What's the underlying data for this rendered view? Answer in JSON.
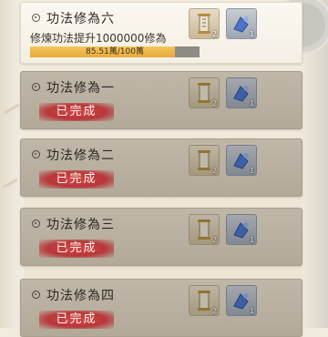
{
  "quests": [
    {
      "title": "功法修為六",
      "description": "修煉功法提升1000000修為",
      "progress_text": "85.51萬/100萬",
      "progress_fraction": 0.8551,
      "rewards": [
        {
          "icon": "scroll-icon",
          "count": "2"
        },
        {
          "icon": "blue-pill-icon",
          "count": "1"
        }
      ]
    },
    {
      "title": "功法修為一",
      "status": "已完成",
      "rewards": [
        {
          "icon": "scroll-icon",
          "count": "2"
        },
        {
          "icon": "blue-pill-icon",
          "count": "1"
        }
      ]
    },
    {
      "title": "功法修為二",
      "status": "已完成",
      "rewards": [
        {
          "icon": "scroll-icon",
          "count": "2"
        },
        {
          "icon": "blue-pill-icon",
          "count": "1"
        }
      ]
    },
    {
      "title": "功法修為三",
      "status": "已完成",
      "rewards": [
        {
          "icon": "scroll-icon",
          "count": "2"
        },
        {
          "icon": "blue-pill-icon",
          "count": "1"
        }
      ]
    },
    {
      "title": "功法修為四",
      "status": "已完成",
      "rewards": [
        {
          "icon": "scroll-icon",
          "count": "2"
        },
        {
          "icon": "blue-pill-icon",
          "count": "1"
        }
      ]
    }
  ],
  "colors": {
    "progress_fill": "#f2b94a",
    "status_badge": "#c23f41",
    "card_done": "#b9b09f",
    "card_active": "#f8f4ec"
  }
}
